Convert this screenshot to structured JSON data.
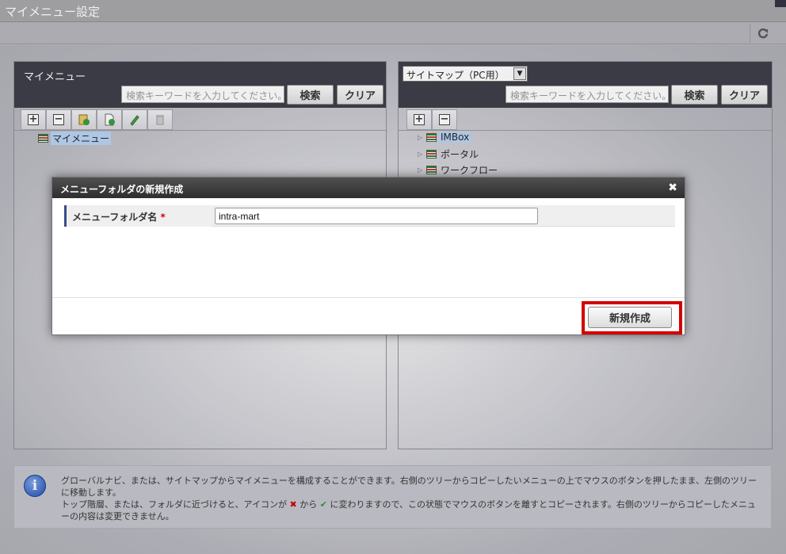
{
  "window": {
    "title": "マイメニュー設定"
  },
  "toolbar": {
    "refresh_icon": "refresh-icon"
  },
  "left_panel": {
    "title": "マイメニュー",
    "search_placeholder": "検索キーワードを入力してください。",
    "search_button": "検索",
    "clear_button": "クリア",
    "tools": [
      "add-icon",
      "remove-icon",
      "import-icon",
      "new-file-icon",
      "edit-icon",
      "delete-icon"
    ],
    "tree": [
      {
        "label": "マイメニュー",
        "selected": true
      }
    ]
  },
  "right_panel": {
    "select_value": "サイトマップ（PC用）",
    "search_placeholder": "検索キーワードを入力してください。",
    "search_button": "検索",
    "clear_button": "クリア",
    "tools": [
      "add-icon",
      "remove-icon"
    ],
    "tree": [
      {
        "label": "IMBox",
        "selected": true
      },
      {
        "label": "ポータル",
        "selected": false
      },
      {
        "label": "ワークフロー",
        "selected": false
      }
    ]
  },
  "dialog": {
    "title": "メニューフォルダの新規作成",
    "close_icon": "close-icon",
    "field_label": "メニューフォルダ名",
    "required_mark": "*",
    "field_value": "intra-mart",
    "create_button": "新規作成"
  },
  "info": {
    "line1": "グローバルナビ、または、サイトマップからマイメニューを構成することができます。右側のツリーからコピーしたいメニューの上でマウスのボタンを押したまま、左側のツリーに移動します。",
    "line2_a": "トップ階層、または、フォルダに近づけると、アイコンが",
    "line2_b": "から",
    "line2_c": "に変わりますので、この状態でマウスのボタンを離すとコピーされます。右側のツリーからコピーしたメニューの内容は変更できません。",
    "x_icon": "✖",
    "check_icon": "✔"
  }
}
